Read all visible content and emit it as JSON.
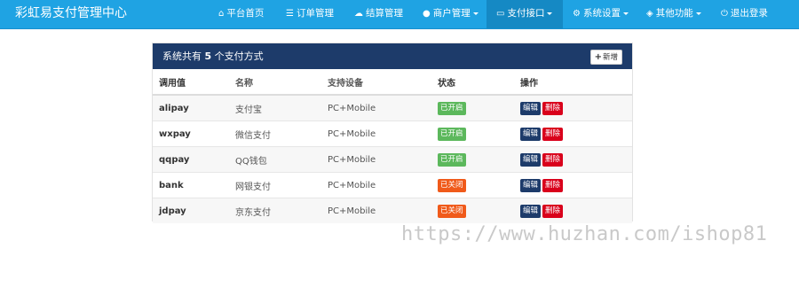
{
  "app": {
    "title": "彩虹易支付管理中心"
  },
  "nav": [
    {
      "label": "平台首页",
      "icon": "home-icon"
    },
    {
      "label": "订单管理",
      "icon": "list-icon"
    },
    {
      "label": "结算管理",
      "icon": "cloud-icon"
    },
    {
      "label": "商户管理",
      "icon": "user-icon",
      "dropdown": true
    },
    {
      "label": "支付接口",
      "icon": "credit-card-icon",
      "dropdown": true,
      "active": true
    },
    {
      "label": "系统设置",
      "icon": "gear-icon",
      "dropdown": true
    },
    {
      "label": "其他功能",
      "icon": "box-icon",
      "dropdown": true
    },
    {
      "label": "退出登录",
      "icon": "power-icon"
    }
  ],
  "panel": {
    "title_prefix": "系统共有",
    "count": "5",
    "title_suffix": "个支付方式",
    "add_label": "新增"
  },
  "table": {
    "headers": [
      "调用值",
      "名称",
      "支持设备",
      "状态",
      "操作"
    ],
    "edit_label": "编辑",
    "delete_label": "删除",
    "rows": [
      {
        "code": "alipay",
        "name": "支付宝",
        "device": "PC+Mobile",
        "status": "已开启",
        "enabled": true
      },
      {
        "code": "wxpay",
        "name": "微信支付",
        "device": "PC+Mobile",
        "status": "已开启",
        "enabled": true
      },
      {
        "code": "qqpay",
        "name": "QQ钱包",
        "device": "PC+Mobile",
        "status": "已开启",
        "enabled": true
      },
      {
        "code": "bank",
        "name": "网银支付",
        "device": "PC+Mobile",
        "status": "已关闭",
        "enabled": false
      },
      {
        "code": "jdpay",
        "name": "京东支付",
        "device": "PC+Mobile",
        "status": "已关闭",
        "enabled": false
      }
    ]
  },
  "watermark": "https://www.huzhan.com/ishop81",
  "colors": {
    "navbar": "#1fa3e3",
    "nav_active": "#1589c4",
    "panel_heading": "#1d3b6a",
    "status_on": "#5cb85c",
    "status_off": "#f05a1a",
    "delete": "#d9001b"
  }
}
